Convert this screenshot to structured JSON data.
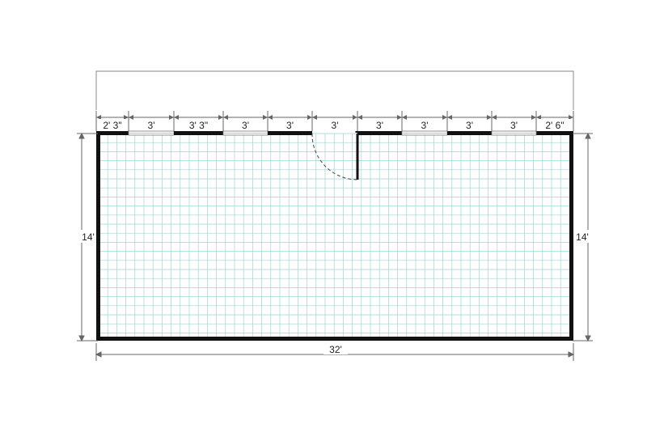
{
  "top_segments": [
    "2' 3\"",
    "3'",
    "3' 3\"",
    "3'",
    "3'",
    "3'",
    "3'",
    "3'",
    "3'",
    "3'",
    "2' 6\""
  ],
  "top_openings": [
    {
      "kind": "window"
    },
    {
      "kind": "wall"
    },
    {
      "kind": "window"
    },
    {
      "kind": "wall"
    },
    {
      "kind": "door"
    },
    {
      "kind": "wall"
    },
    {
      "kind": "window"
    },
    {
      "kind": "wall"
    },
    {
      "kind": "window"
    }
  ],
  "left_dimension": "14'",
  "right_dimension": "14'",
  "bottom_dimension": "32'",
  "colors": {
    "wall": "#111111",
    "grid": "#9dd3d3",
    "dimension_line": "#666666",
    "window": "#bfbfbf"
  }
}
